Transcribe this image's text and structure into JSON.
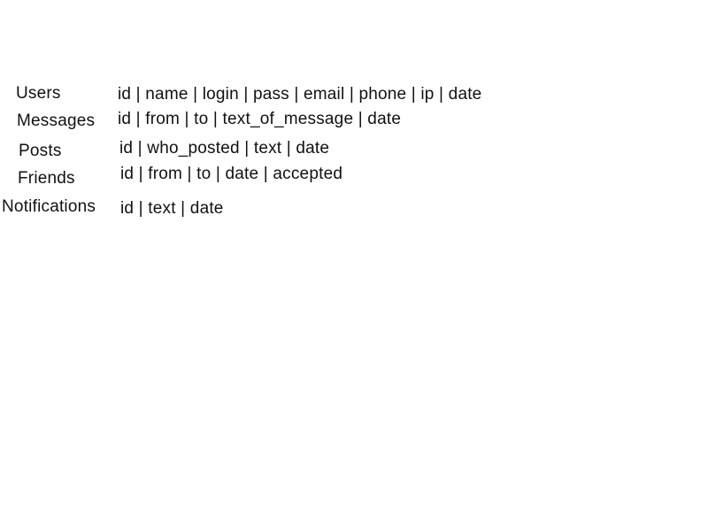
{
  "tables": [
    {
      "name": "Users",
      "fields": "id | name | login | pass | email | phone | ip |  date"
    },
    {
      "name": "Messages",
      "fields": "id | from | to | text_of_message | date"
    },
    {
      "name": "Posts",
      "fields": "id | who_posted | text |  date"
    },
    {
      "name": "Friends",
      "fields": "id | from | to | date | accepted"
    },
    {
      "name": "Notifications",
      "fields": "id | text  | date"
    }
  ]
}
